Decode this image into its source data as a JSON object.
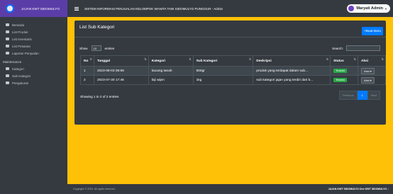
{
  "brand": {
    "text": "JAJAN KWT SIDOMULYO"
  },
  "topbar": {
    "title": "SISTEM INFORMASI PENJUALAN KELOMPOK WANITA TANI SIDOMULYO PUNGGUR - Admin"
  },
  "user": {
    "name": "Maryati Admin"
  },
  "sidebar": {
    "items": [
      {
        "label": "Beranda",
        "icon": "dashboard-icon"
      },
      {
        "label": "List Produk",
        "icon": "list-icon"
      },
      {
        "label": "List Inventaris",
        "icon": "inventory-icon"
      },
      {
        "label": "List Pesanan",
        "icon": "orders-icon"
      },
      {
        "label": "Laporan Penjualan",
        "icon": "report-icon"
      }
    ],
    "header": "Maintenance",
    "items2": [
      {
        "label": "Kategori",
        "icon": "category-icon"
      },
      {
        "label": "Sub Kategori",
        "icon": "subcategory-icon"
      },
      {
        "label": "Pengaturan",
        "icon": "gear-icon"
      }
    ]
  },
  "card": {
    "title": "List Sub Kategori",
    "add_label": "+Buat Baru"
  },
  "controls": {
    "show_label": "Show",
    "show_value": "10",
    "entries_label": "entries",
    "search_label": "Search:"
  },
  "table": {
    "headers": [
      "No",
      "Tanggal",
      "Kategori",
      "Sub Kategori",
      "Deskripsi",
      "Status",
      "Aksi"
    ],
    "rows": [
      {
        "no": "1",
        "tanggal": "2023-08-03 06:59",
        "kategori": "kacang tanah",
        "sub": "500gr",
        "deskripsi": "produk yang terdapat dalam sub...",
        "status": "Tersedia",
        "aksi": "Aksi ▾"
      },
      {
        "no": "2",
        "tanggal": "2023-07-30 17:46",
        "kategori": "biji wijen",
        "sub": "1kg",
        "deskripsi": "sub kategori jajan yang terdiri dari b...",
        "status": "Tersedia",
        "aksi": "Aksi ▾"
      }
    ]
  },
  "info": "Showing 1 to 2 of 2 entries",
  "pagination": {
    "prev": "Previous",
    "page": "1",
    "next": "Next"
  },
  "footer": {
    "left": "Copyright © 2023. All rights reserved.",
    "right_prefix": "JAJAN KWT SIDOMULYO",
    "right_by": "Dev KWT SIDOMULYO",
    "right_suffix": "v"
  }
}
